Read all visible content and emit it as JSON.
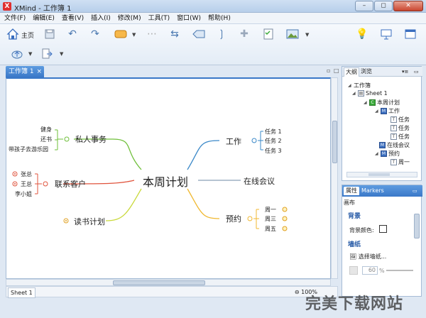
{
  "window": {
    "title": "XMind - 工作簿 1",
    "logo": "X"
  },
  "menu": [
    "文件(F)",
    "编辑(E)",
    "查看(V)",
    "插入(I)",
    "修改(M)",
    "工具(T)",
    "窗口(W)",
    "帮助(H)"
  ],
  "toolbar": {
    "home_label": "主页"
  },
  "doc_tab": {
    "label": "工作簿 1",
    "close": "×"
  },
  "mindmap": {
    "central": "本周计划",
    "branches": {
      "private": {
        "label": "私人事务",
        "children": [
          "健身",
          "还书",
          "带孩子去游乐园"
        ]
      },
      "contacts": {
        "label": "联系客户",
        "children": [
          "张总",
          "王总",
          "李小姐"
        ]
      },
      "reading": {
        "label": "读书计划"
      },
      "work": {
        "label": "工作",
        "children": [
          "任务 1",
          "任务 2",
          "任务 3"
        ]
      },
      "meeting": {
        "label": "在线会议"
      },
      "appointment": {
        "label": "预约",
        "children": [
          "周一",
          "周三",
          "周五"
        ]
      }
    },
    "colors": {
      "private": "#6fbf3a",
      "contacts": "#e0533c",
      "reading": "#c9d93a",
      "work": "#3a88c8",
      "meeting": "#8aa0b8",
      "appointment": "#f0b830"
    }
  },
  "sheet_tab": "Sheet 1",
  "zoom": "100%",
  "outline_panel": {
    "tabs": [
      "大纲",
      "浏览"
    ],
    "items": [
      {
        "label": "工作簿",
        "icon": "none"
      },
      {
        "label": "Sheet 1",
        "icon": "sheet"
      },
      {
        "label": "本周计划",
        "icon": "C"
      },
      {
        "label": "工作",
        "icon": "M"
      },
      {
        "label": "任务",
        "icon": "T"
      },
      {
        "label": "任务",
        "icon": "T"
      },
      {
        "label": "任务",
        "icon": "T"
      },
      {
        "label": "在线会议",
        "icon": "M"
      },
      {
        "label": "预约",
        "icon": "M"
      },
      {
        "label": "周一",
        "icon": "T"
      }
    ]
  },
  "properties_panel": {
    "tabs": [
      "属性",
      "Markers"
    ],
    "subtitle": "画布",
    "background_heading": "背景",
    "background_color_label": "背景颜色:",
    "wallpaper_heading": "墙纸",
    "choose_wallpaper": "选择墙纸...",
    "opacity_value": "60",
    "opacity_unit": "%"
  },
  "watermark": "完美下载网站"
}
